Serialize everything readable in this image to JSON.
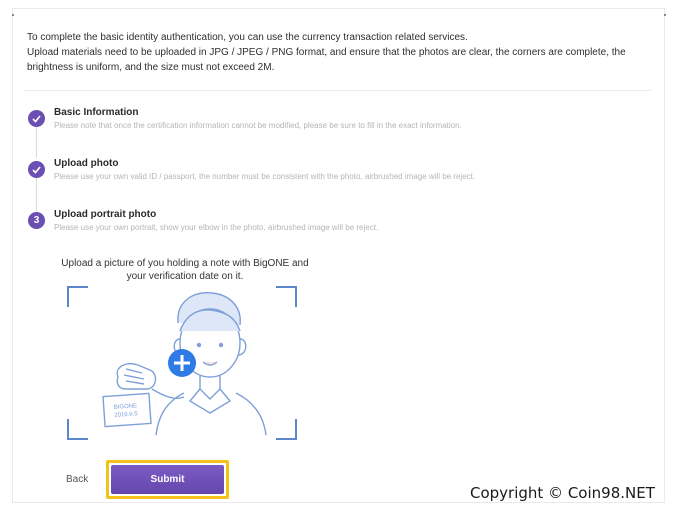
{
  "intro": {
    "line1": "To complete the basic identity authentication, you can use the currency transaction related services.",
    "line2": "Upload materials need to be uploaded in JPG / JPEG / PNG format, and ensure that the photos are clear, the corners are complete, the brightness is uniform, and the size must not exceed 2M."
  },
  "steps": [
    {
      "title": "Basic Information",
      "description": "Please note that once the certification information cannot be modified, please be sure to fill in the exact information.",
      "state": "completed",
      "icon": "check-icon"
    },
    {
      "title": "Upload photo",
      "description": "Please use your own valid ID / passport, the number must be consistent with the photo, airbrushed image will be reject.",
      "state": "completed",
      "icon": "check-icon"
    },
    {
      "number": "3",
      "title": "Upload portrait photo",
      "description": "Please use your own portrait, show your elbow in the photo, airbrushed image will be reject.",
      "state": "current"
    }
  ],
  "upload": {
    "instruction_line1": "Upload a picture of you holding a note with BigONE and",
    "instruction_line2": "your verification date on it.",
    "note_text_line1": "BIGONE",
    "note_text_line2": "2019.6.5",
    "add_icon": "plus-icon"
  },
  "actions": {
    "back_label": "Back",
    "submit_label": "Submit"
  },
  "watermark": "Copyright © Coin98.NET",
  "colors": {
    "accent": "#6b4fb3",
    "submit_highlight": "#f2c31b",
    "upload_blue": "#2f7be5",
    "frame_blue": "#5b86c9"
  }
}
